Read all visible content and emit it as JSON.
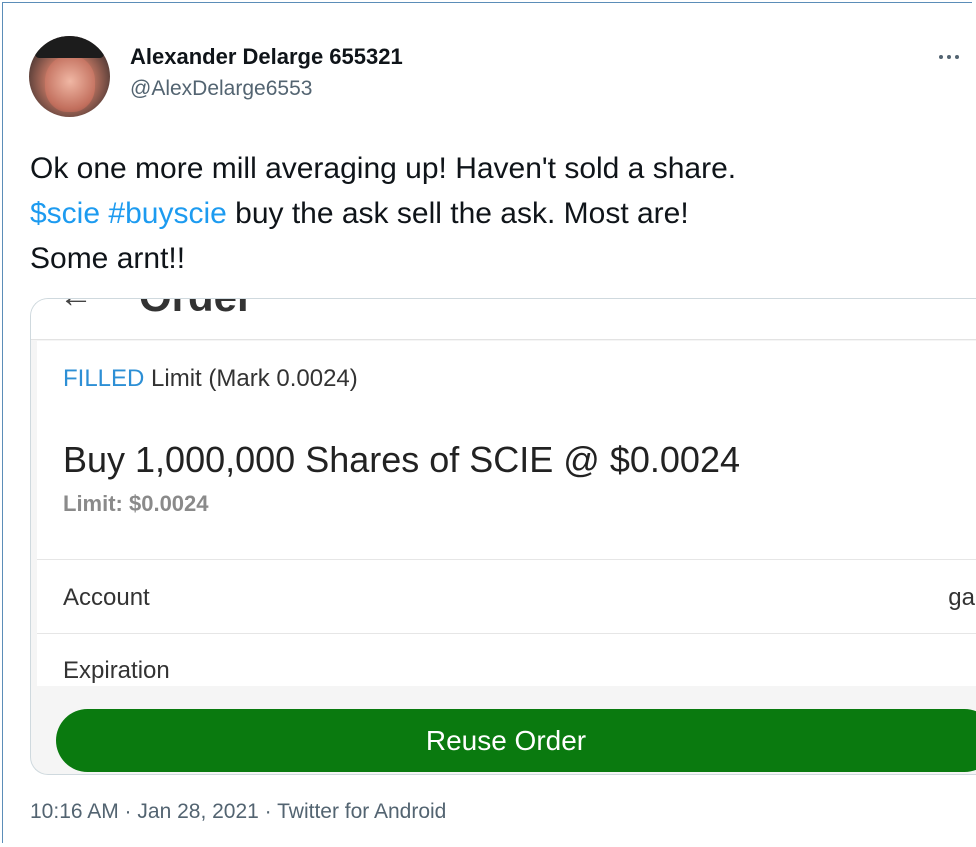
{
  "author": {
    "display_name": "Alexander Delarge 655321",
    "handle": "@AlexDelarge6553"
  },
  "tweet": {
    "text_line1": "Ok one more mill averaging up! Haven't sold a share.",
    "cashtag": "$scie",
    "hashtag": "#buyscie",
    "text_line2_rest": " buy the ask sell the ask. Most are!",
    "text_line3": "Some arnt!!"
  },
  "media": {
    "header_title": "Order",
    "status_label": "FILLED",
    "status_text": " Limit  (Mark 0.0024)",
    "order_summary": "Buy 1,000,000 Shares of SCIE @ $0.0024",
    "limit_text": "Limit: $0.0024",
    "account_label": "Account",
    "account_value": "ga",
    "expiration_label": "Expiration",
    "reuse_button_label": "Reuse Order"
  },
  "meta": {
    "timestamp_line": "10:16 AM · Jan 28, 2021 · Twitter for Android"
  },
  "colors": {
    "link": "#1d9bf0",
    "filled_status": "#2d8fd5",
    "reuse_button": "#0a7a0f"
  },
  "icons": [
    "more-icon",
    "back-arrow-icon"
  ]
}
